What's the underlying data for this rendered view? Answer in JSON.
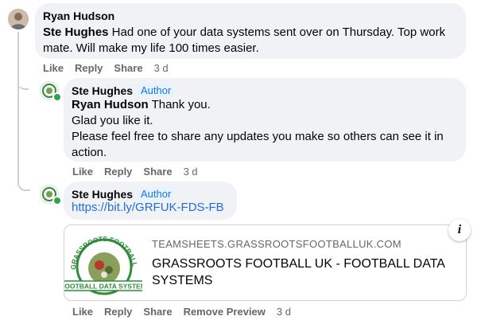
{
  "comment1": {
    "author": "Ryan Hudson",
    "mention": "Ste Hughes",
    "text": " Had one of your data systems sent over on Thursday. Top work mate. Will make my life 100 times easier.",
    "actions": {
      "like": "Like",
      "reply": "Reply",
      "share": "Share",
      "time": "3 d"
    }
  },
  "reply1": {
    "author": "Ste Hughes",
    "badge": "Author",
    "mention": "Ryan Hudson",
    "line1": " Thank you.",
    "line2": "Glad you like it.",
    "line3": "Please feel free to share any updates you make so others can see it in action.",
    "actions": {
      "like": "Like",
      "reply": "Reply",
      "share": "Share",
      "time": "3 d"
    }
  },
  "reply2": {
    "author": "Ste Hughes",
    "badge": "Author",
    "link": "https://bit.ly/GRFUK-FDS-FB",
    "preview": {
      "domain": "TEAMSHEETS.GRASSROOTSFOOTBALLUK.COM",
      "title": "GRASSROOTS FOOTBALL UK - FOOTBALL DATA SYSTEMS",
      "logo_arc_text": "GRASSROOTS FOOTBALL UK",
      "logo_banner": "FOOTBALL DATA SYSTEM"
    },
    "actions": {
      "like": "Like",
      "reply": "Reply",
      "share": "Share",
      "remove_preview": "Remove Preview",
      "time": "3 d"
    }
  },
  "icons": {
    "info": "i"
  },
  "colors": {
    "link": "#216fdb",
    "author_badge": "#1b74e4",
    "online": "#31a24c",
    "logo_green": "#2e8b3a",
    "logo_red": "#c0392b"
  }
}
